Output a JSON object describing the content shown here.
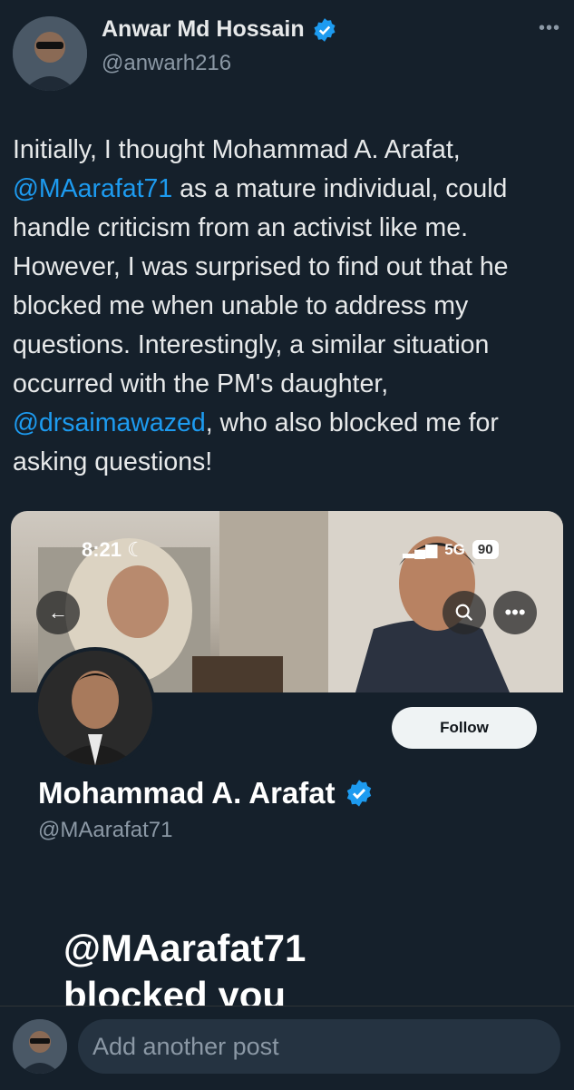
{
  "author": {
    "name": "Anwar Md Hossain",
    "handle": "@anwarh216",
    "verified": true
  },
  "tweet": {
    "text_1": "Initially, I thought Mohammad A. Arafat,",
    "mention_1": "@MAarafat71",
    "text_2": " as a mature individual, could handle criticism from an activist like me. However, I was surprised to find out that he blocked me when unable to address my questions. Interestingly, a similar situation occurred with the PM's daughter, ",
    "mention_2": "@drsaimawazed",
    "text_3": ", who also blocked me for asking questions!"
  },
  "embedded_screenshot": {
    "status_bar": {
      "time": "8:21",
      "network": "5G",
      "battery": "90"
    },
    "profile": {
      "name": "Mohammad A. Arafat",
      "handle": "@MAarafat71",
      "verified": true,
      "follow_label": "Follow"
    },
    "blocked_line_1": "@MAarafat71",
    "blocked_line_2": "blocked you"
  },
  "reply": {
    "placeholder": "Add another post"
  },
  "icons": {
    "more": "more-icon",
    "back": "back-arrow-icon",
    "search": "search-icon",
    "overflow": "overflow-icon",
    "verified": "verified-badge-icon"
  },
  "colors": {
    "background": "#15202b",
    "link": "#1d9bf0",
    "verified": "#1d9bf0"
  }
}
